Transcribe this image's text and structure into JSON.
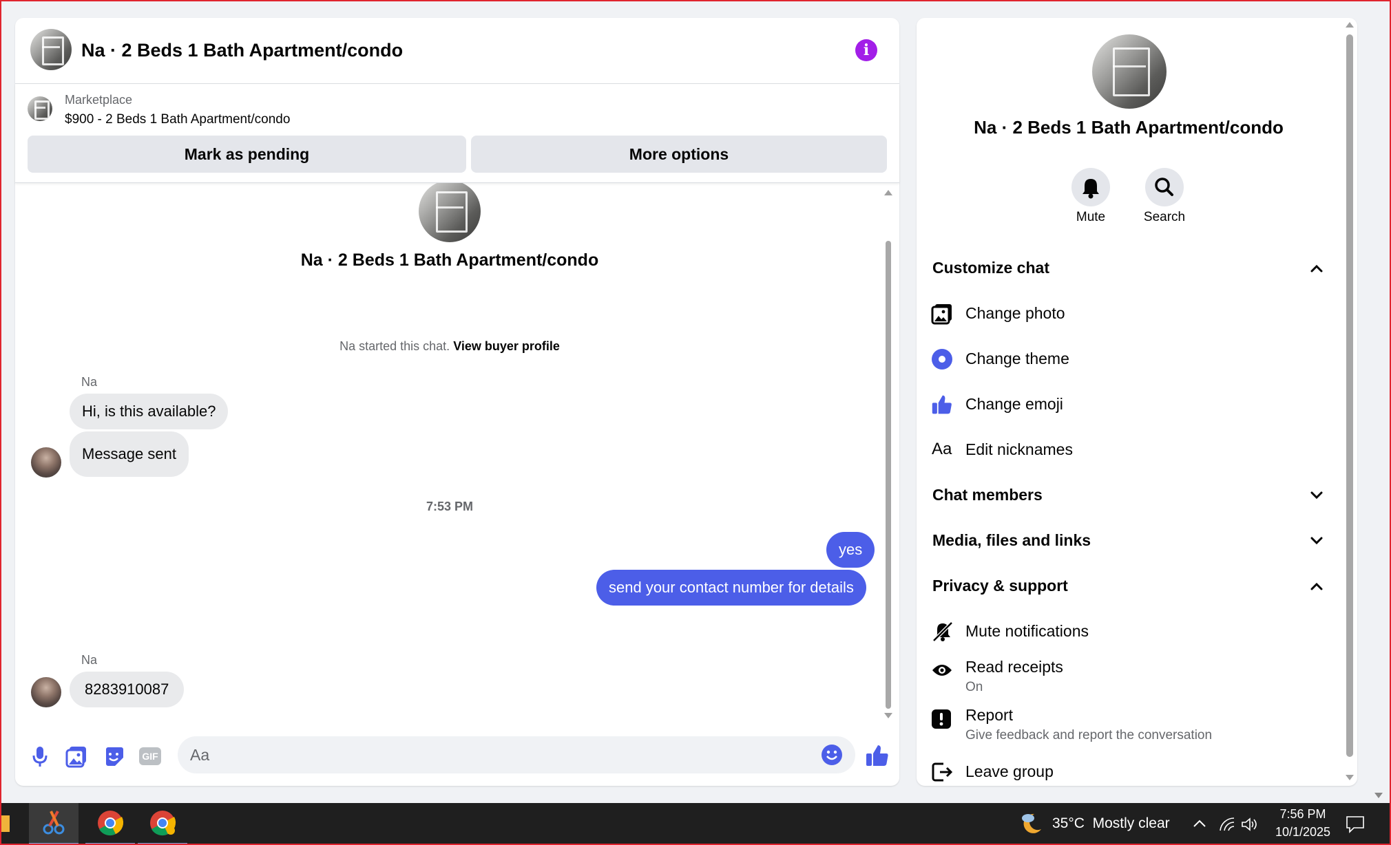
{
  "header": {
    "title": "Na · 2 Beds 1 Bath Apartment/condo"
  },
  "listing": {
    "source": "Marketplace",
    "summary": "$900 - 2 Beds 1 Bath Apartment/condo",
    "pending_label": "Mark as pending",
    "more_label": "More options"
  },
  "chat": {
    "profile_name": "Na · 2 Beds 1 Bath Apartment/condo",
    "started_prefix": "Na started this chat.",
    "view_buyer": "View buyer profile",
    "sender_1": "Na",
    "msg_1": "Hi, is this available?",
    "msg_2": "Message sent",
    "timestamp": "7:53 PM",
    "out_1": "yes",
    "out_2": "send your contact number for details",
    "sender_2": "Na",
    "msg_3": "8283910087"
  },
  "composer": {
    "placeholder": "Aa"
  },
  "sidebar": {
    "name": "Na · 2 Beds 1 Bath Apartment/condo",
    "mute_label": "Mute",
    "search_label": "Search",
    "customize_title": "Customize chat",
    "change_photo": "Change photo",
    "change_theme": "Change theme",
    "change_emoji": "Change emoji",
    "edit_nicknames": "Edit nicknames",
    "nick_icon": "Aa",
    "chat_members": "Chat members",
    "media": "Media, files and links",
    "privacy_title": "Privacy & support",
    "mute_notifications": "Mute notifications",
    "read_receipts": "Read receipts",
    "read_receipts_state": "On",
    "report": "Report",
    "report_sub": "Give feedback and report the conversation",
    "leave_group": "Leave group"
  },
  "taskbar": {
    "weather": "35°C  Mostly clear",
    "time": "7:56 PM",
    "date": "10/1/2025"
  },
  "colors": {
    "accent": "#4c5ee8",
    "info_purple": "#a21ee8",
    "background": "#f0f2f5",
    "taskbar": "#1f1f1f"
  }
}
